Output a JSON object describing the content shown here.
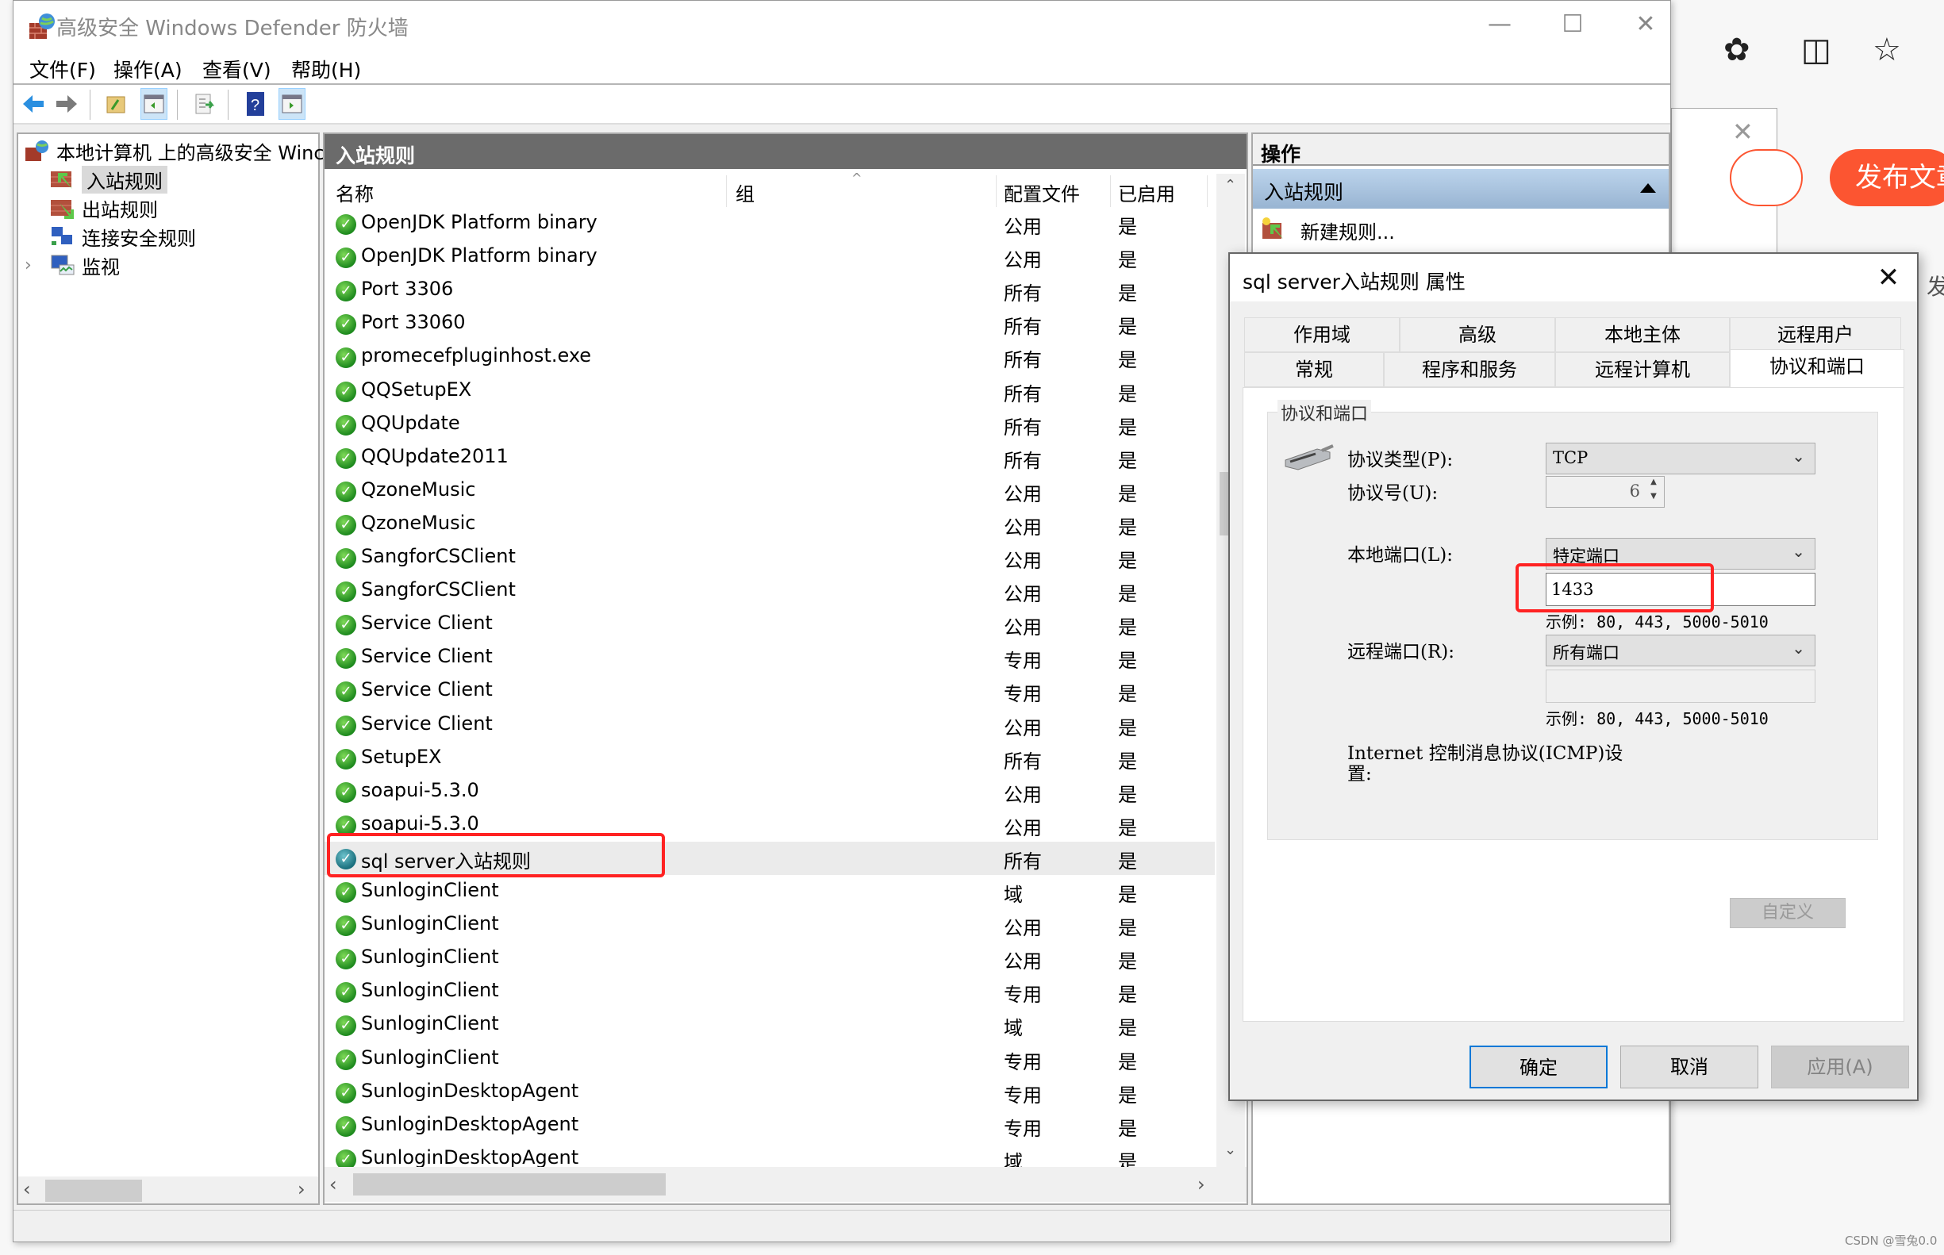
{
  "browser": {
    "publish_button": "发布文章",
    "side_text": "发",
    "watermark": "CSDN @雪兔0.0"
  },
  "window": {
    "title": "高级安全 Windows Defender 防火墙",
    "menu": [
      "文件(F)",
      "操作(A)",
      "查看(V)",
      "帮助(H)"
    ]
  },
  "tree": {
    "root": "本地计算机 上的高级安全 Winc",
    "items": [
      {
        "label": "入站规则",
        "selected": true
      },
      {
        "label": "出站规则",
        "selected": false
      },
      {
        "label": "连接安全规则",
        "selected": false
      },
      {
        "label": "监视",
        "selected": false,
        "expandable": true
      }
    ]
  },
  "main": {
    "header": "入站规则",
    "columns": [
      "名称",
      "组",
      "配置文件",
      "已启用"
    ],
    "rows": [
      {
        "name": "OpenJDK Platform binary",
        "profile": "公用",
        "enabled": "是"
      },
      {
        "name": "OpenJDK Platform binary",
        "profile": "公用",
        "enabled": "是"
      },
      {
        "name": "Port 3306",
        "profile": "所有",
        "enabled": "是"
      },
      {
        "name": "Port 33060",
        "profile": "所有",
        "enabled": "是"
      },
      {
        "name": "promecefpluginhost.exe",
        "profile": "所有",
        "enabled": "是"
      },
      {
        "name": "QQSetupEX",
        "profile": "所有",
        "enabled": "是"
      },
      {
        "name": "QQUpdate",
        "profile": "所有",
        "enabled": "是"
      },
      {
        "name": "QQUpdate2011",
        "profile": "所有",
        "enabled": "是"
      },
      {
        "name": "QzoneMusic",
        "profile": "公用",
        "enabled": "是"
      },
      {
        "name": "QzoneMusic",
        "profile": "公用",
        "enabled": "是"
      },
      {
        "name": "SangforCSClient",
        "profile": "公用",
        "enabled": "是"
      },
      {
        "name": "SangforCSClient",
        "profile": "公用",
        "enabled": "是"
      },
      {
        "name": "Service Client",
        "profile": "公用",
        "enabled": "是"
      },
      {
        "name": "Service Client",
        "profile": "专用",
        "enabled": "是"
      },
      {
        "name": "Service Client",
        "profile": "专用",
        "enabled": "是"
      },
      {
        "name": "Service Client",
        "profile": "公用",
        "enabled": "是"
      },
      {
        "name": "SetupEX",
        "profile": "所有",
        "enabled": "是"
      },
      {
        "name": "soapui-5.3.0",
        "profile": "公用",
        "enabled": "是"
      },
      {
        "name": "soapui-5.3.0",
        "profile": "公用",
        "enabled": "是"
      },
      {
        "name": "sql server入站规则",
        "profile": "所有",
        "enabled": "是",
        "selected": true
      },
      {
        "name": "SunloginClient",
        "profile": "域",
        "enabled": "是"
      },
      {
        "name": "SunloginClient",
        "profile": "公用",
        "enabled": "是"
      },
      {
        "name": "SunloginClient",
        "profile": "公用",
        "enabled": "是"
      },
      {
        "name": "SunloginClient",
        "profile": "专用",
        "enabled": "是"
      },
      {
        "name": "SunloginClient",
        "profile": "域",
        "enabled": "是"
      },
      {
        "name": "SunloginClient",
        "profile": "专用",
        "enabled": "是"
      },
      {
        "name": "SunloginDesktopAgent",
        "profile": "专用",
        "enabled": "是"
      },
      {
        "name": "SunloginDesktopAgent",
        "profile": "专用",
        "enabled": "是"
      },
      {
        "name": "SunloginDesktopAgent",
        "profile": "域",
        "enabled": "是"
      }
    ]
  },
  "actions": {
    "header": "操作",
    "section": "入站规则",
    "items": [
      "新建规则..."
    ]
  },
  "dialog": {
    "title": "sql server入站规则 属性",
    "tabs_row1": [
      "作用域",
      "高级",
      "本地主体",
      "远程用户"
    ],
    "tabs_row2": [
      "常规",
      "程序和服务",
      "远程计算机",
      "协议和端口"
    ],
    "active_tab": "协议和端口",
    "group_label": "协议和端口",
    "protocol_type_label": "协议类型(P):",
    "protocol_type_value": "TCP",
    "protocol_number_label": "协议号(U):",
    "protocol_number_value": "6",
    "local_port_label": "本地端口(L):",
    "local_port_mode": "特定端口",
    "local_port_value": "1433",
    "local_port_hint": "示例: 80, 443, 5000-5010",
    "remote_port_label": "远程端口(R):",
    "remote_port_mode": "所有端口",
    "remote_port_value": "",
    "remote_port_hint": "示例: 80, 443, 5000-5010",
    "icmp_label_line1": "Internet 控制消息协议(ICMP)设",
    "icmp_label_line2": "置:",
    "customize_button": "自定义",
    "ok_button": "确定",
    "cancel_button": "取消",
    "apply_button": "应用(A)"
  }
}
